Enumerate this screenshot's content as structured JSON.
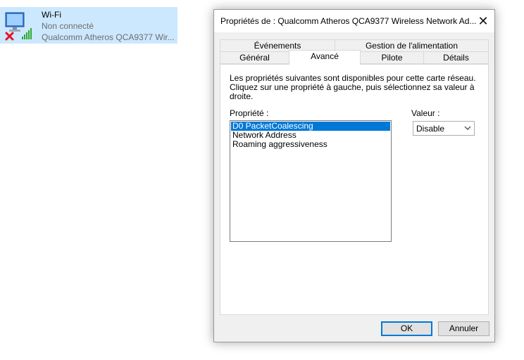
{
  "network_item": {
    "name": "Wi-Fi",
    "status": "Non connecté",
    "adapter": "Qualcomm Atheros QCA9377 Wir..."
  },
  "dialog": {
    "title": "Propriétés de : Qualcomm Atheros QCA9377 Wireless Network Ad...",
    "tabs_row1": [
      "Événements",
      "Gestion de l'alimentation"
    ],
    "tabs_row2": [
      "Général",
      "Avancé",
      "Pilote",
      "Détails"
    ],
    "active_tab": "Avancé",
    "description": "Les propriétés suivantes sont disponibles pour cette carte réseau. Cliquez sur une propriété à gauche, puis sélectionnez sa valeur à droite.",
    "property_label": "Propriété :",
    "value_label": "Valeur :",
    "properties": [
      "D0 PacketCoalescing",
      "Network Address",
      "Roaming aggressiveness"
    ],
    "selected_property": "D0 PacketCoalescing",
    "value": "Disable",
    "ok_label": "OK",
    "cancel_label": "Annuler"
  },
  "colors": {
    "selection": "#0078d7",
    "item_highlight": "#cce8ff",
    "disconnected_x": "#e81123",
    "signal_bars": "#2fa82f"
  }
}
